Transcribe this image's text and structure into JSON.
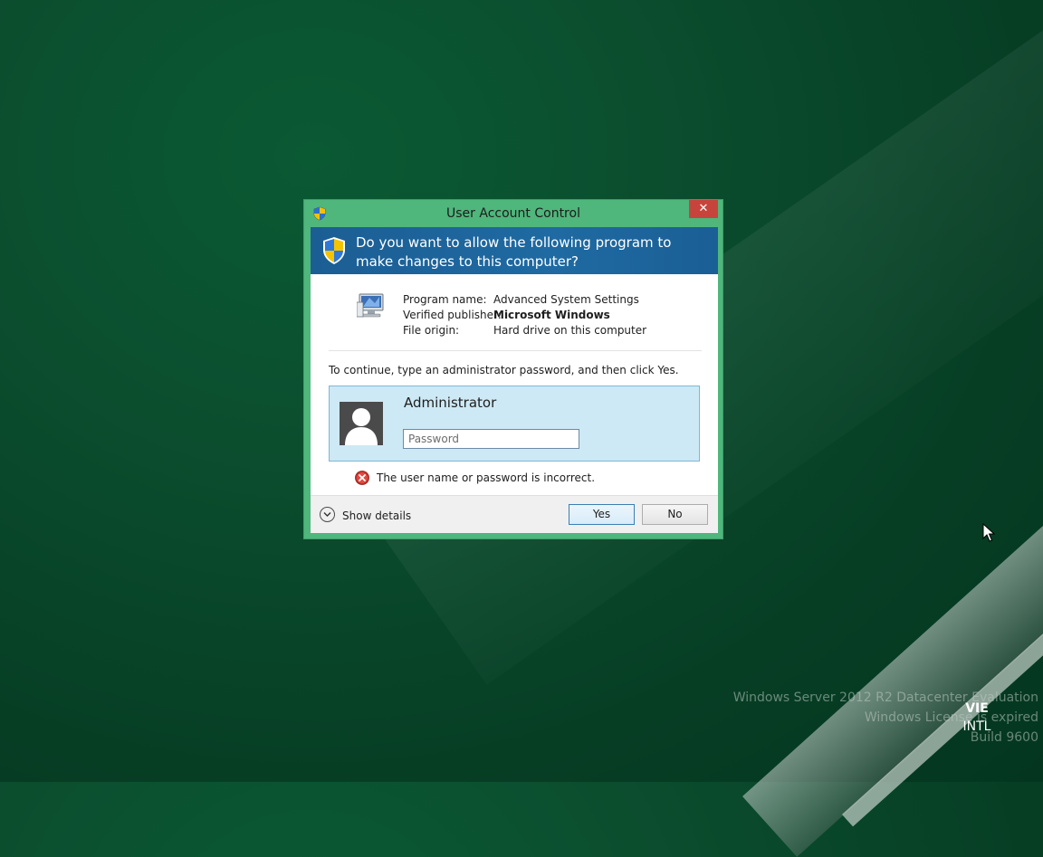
{
  "dialog": {
    "title": "User Account Control",
    "close_glyph": "✕",
    "question": "Do you want to allow the following program to make changes to this computer?",
    "program_label": "Program name:",
    "program_value": "Advanced System Settings",
    "publisher_label": "Verified publisher:",
    "publisher_value": "Microsoft Windows",
    "origin_label": "File origin:",
    "origin_value": "Hard drive on this computer",
    "instruction": "To continue, type an administrator password, and then click Yes.",
    "username": "Administrator",
    "password_placeholder": "Password",
    "password_value": "",
    "error_message": "The user name or password is incorrect.",
    "show_details": "Show details",
    "yes_label": "Yes",
    "no_label": "No"
  },
  "desktop": {
    "watermark_line1": "Windows Server 2012 R2 Datacenter Evaluation",
    "watermark_line2": "Windows License is expired",
    "watermark_line3": "Build 9600",
    "lang_primary": "VIE",
    "lang_secondary": "INTL"
  },
  "icons": {
    "title_icon": "uac-shield-icon",
    "banner_icon": "uac-shield-icon",
    "program_icon": "computer-settings-icon",
    "error_icon": "error-x-icon",
    "details_icon": "chevron-down-circle-icon",
    "avatar": "user-avatar-icon"
  },
  "colors": {
    "window_frame": "#4fb67c",
    "banner": "#1f6aa2",
    "cred_box": "#cde9f5",
    "close_button": "#c7443c",
    "desktop": "#0b4d2e"
  }
}
